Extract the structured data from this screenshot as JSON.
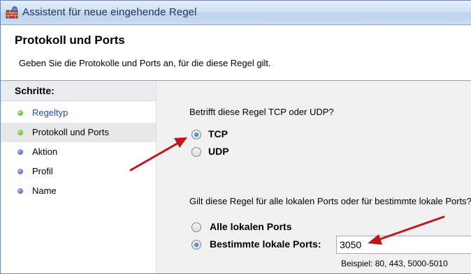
{
  "window": {
    "title": "Assistent für neue eingehende Regel",
    "heading": "Protokoll und Ports",
    "subheading": "Geben Sie die Protokolle und Ports an, für die diese Regel gilt."
  },
  "steps": {
    "title": "Schritte:",
    "items": [
      {
        "label": "Regeltyp",
        "state": "completed"
      },
      {
        "label": "Protokoll und Ports",
        "state": "current"
      },
      {
        "label": "Aktion",
        "state": "pending"
      },
      {
        "label": "Profil",
        "state": "pending"
      },
      {
        "label": "Name",
        "state": "pending"
      }
    ]
  },
  "protocol": {
    "question": "Betrifft diese Regel TCP oder UDP?",
    "options": [
      {
        "label": "TCP",
        "selected": true
      },
      {
        "label": "UDP",
        "selected": false
      }
    ]
  },
  "ports": {
    "question": "Gilt diese Regel für alle lokalen Ports oder für bestimmte lokale Ports?",
    "options": [
      {
        "label": "Alle lokalen Ports",
        "selected": false
      },
      {
        "label": "Bestimmte lokale Ports:",
        "selected": true
      }
    ],
    "value": "3050",
    "example": "Beispiel: 80, 443, 5000-5010"
  },
  "colors": {
    "titlebar": "#c9dcf3",
    "completed_dot": "#35a31a",
    "pending_dot": "#3a4bb8",
    "link_text": "#1b4fa0",
    "annotation_arrow": "#c0161b"
  }
}
